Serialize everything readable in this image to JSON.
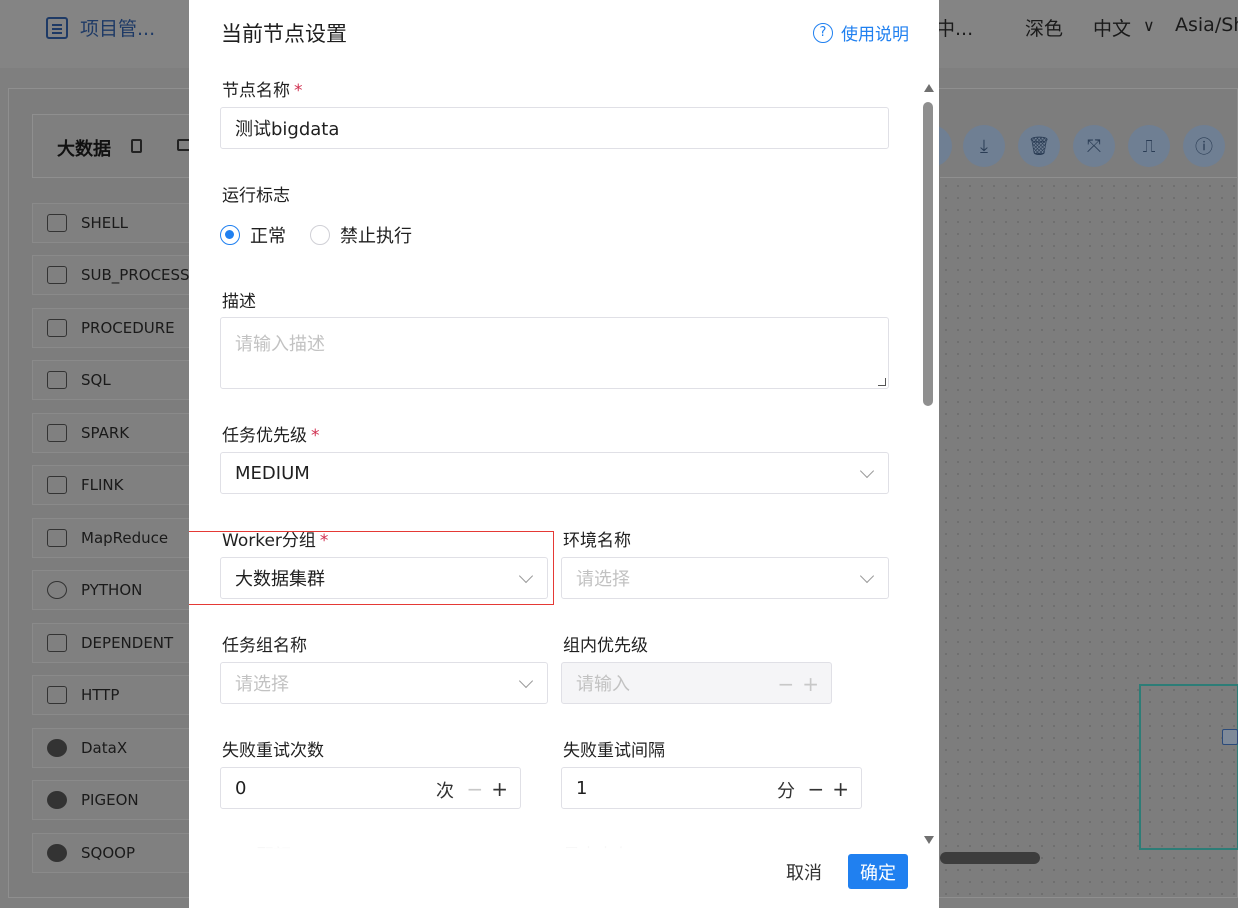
{
  "header": {
    "project": "项目管...",
    "middle_fragment": "中...",
    "theme": "深色",
    "language": "中文",
    "timezone": "Asia/Sh"
  },
  "sidebar": {
    "title": "大数据",
    "tools": [
      {
        "label": "SHELL",
        "icon": "terminal-icon"
      },
      {
        "label": "SUB_PROCESS",
        "icon": "sub-process-icon"
      },
      {
        "label": "PROCEDURE",
        "icon": "database-icon"
      },
      {
        "label": "SQL",
        "icon": "sql-database-icon"
      },
      {
        "label": "SPARK",
        "icon": "spark-star-icon"
      },
      {
        "label": "FLINK",
        "icon": "flink-squirrel-icon"
      },
      {
        "label": "MapReduce",
        "icon": "mapreduce-icon"
      },
      {
        "label": "PYTHON",
        "icon": "python-icon"
      },
      {
        "label": "DEPENDENT",
        "icon": "dependent-icon"
      },
      {
        "label": "HTTP",
        "icon": "http-icon"
      },
      {
        "label": "DataX",
        "icon": "datax-icon"
      },
      {
        "label": "PIGEON",
        "icon": "pigeon-icon"
      },
      {
        "label": "SQOOP",
        "icon": "sqoop-icon"
      }
    ]
  },
  "modal": {
    "title": "当前节点设置",
    "help_label": "使用说明",
    "node_name_label": "节点名称",
    "node_name_value": "测试bigdata",
    "run_flag_label": "运行标志",
    "run_flag_options": [
      "正常",
      "禁止执行"
    ],
    "run_flag_selected": "正常",
    "description_label": "描述",
    "description_placeholder": "请输入描述",
    "priority_label": "任务优先级",
    "priority_value": "MEDIUM",
    "worker_group_label": "Worker分组",
    "worker_group_value": "大数据集群",
    "env_label": "环境名称",
    "env_placeholder": "请选择",
    "task_group_label": "任务组名称",
    "task_group_placeholder": "请选择",
    "group_priority_label": "组内优先级",
    "group_priority_placeholder": "请输入",
    "retry_times_label": "失败重试次数",
    "retry_times_value": "0",
    "retry_times_unit": "次",
    "retry_interval_label": "失败重试间隔",
    "retry_interval_value": "1",
    "retry_interval_unit": "分",
    "cpu_label": "CPU配额",
    "memory_label": "最大内存",
    "cancel_label": "取消",
    "confirm_label": "确定",
    "required_mark": "*",
    "minus": "−",
    "plus": "+"
  },
  "colors": {
    "primary": "#2080f0",
    "required": "#d03050",
    "highlight_box": "#e53935"
  }
}
